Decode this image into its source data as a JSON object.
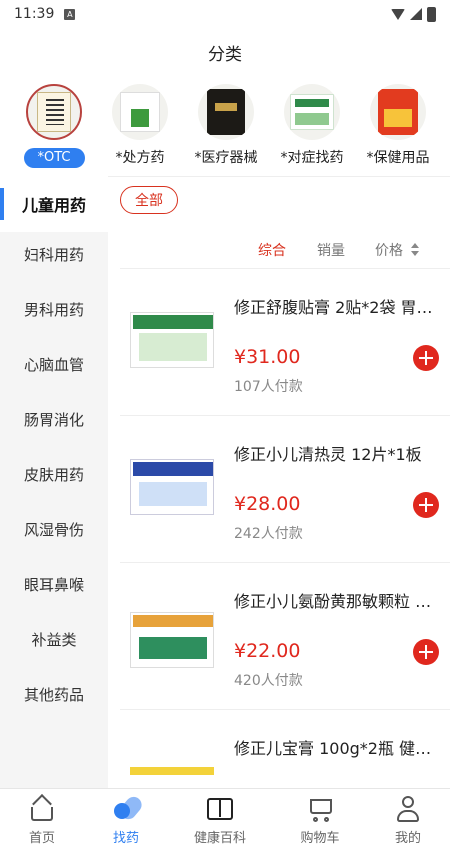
{
  "status_bar": {
    "time": "11:39",
    "notification_letter": "A"
  },
  "header": {
    "title": "分类"
  },
  "categories": [
    {
      "label": "*OTC",
      "icon": "otc-medicine-box-icon",
      "active": true
    },
    {
      "label": "*处方药",
      "icon": "prescription-box-icon",
      "active": false
    },
    {
      "label": "*医疗器械",
      "icon": "medical-device-box-icon",
      "active": false
    },
    {
      "label": "*对症找药",
      "icon": "symptom-medicine-box-icon",
      "active": false
    },
    {
      "label": "*保健用品",
      "icon": "health-product-box-icon",
      "active": false
    }
  ],
  "sidebar": {
    "items": [
      {
        "label": "儿童用药",
        "active": true
      },
      {
        "label": "妇科用药"
      },
      {
        "label": "男科用药"
      },
      {
        "label": "心脑血管"
      },
      {
        "label": "肠胃消化"
      },
      {
        "label": "皮肤用药"
      },
      {
        "label": "风湿骨伤"
      },
      {
        "label": "眼耳鼻喉"
      },
      {
        "label": "补益类"
      },
      {
        "label": "其他药品"
      }
    ]
  },
  "filter": {
    "all_label": "全部"
  },
  "sort": {
    "comprehensive": "综合",
    "sales": "销量",
    "price": "价格",
    "active": "comprehensive"
  },
  "products": [
    {
      "name": "修正舒腹贴膏 2贴*2袋 胃…",
      "price": "¥31.00",
      "sold": "107人付款"
    },
    {
      "name": "修正小儿清热灵 12片*1板",
      "price": "¥28.00",
      "sold": "242人付款"
    },
    {
      "name": "修正小儿氨酚黄那敏颗粒 1…",
      "price": "¥22.00",
      "sold": "420人付款"
    },
    {
      "name": "修正儿宝膏 100g*2瓶 健脾…",
      "price": "",
      "sold": ""
    }
  ],
  "tabbar": {
    "items": [
      {
        "label": "首页",
        "icon": "home-icon"
      },
      {
        "label": "找药",
        "icon": "find-medicine-icon",
        "active": true
      },
      {
        "label": "健康百科",
        "icon": "health-encyclopedia-icon"
      },
      {
        "label": "购物车",
        "icon": "cart-icon"
      },
      {
        "label": "我的",
        "icon": "profile-icon"
      }
    ]
  },
  "colors": {
    "accent_blue": "#2f7ff0",
    "price_red": "#e0281e",
    "filter_red": "#d8321f"
  }
}
